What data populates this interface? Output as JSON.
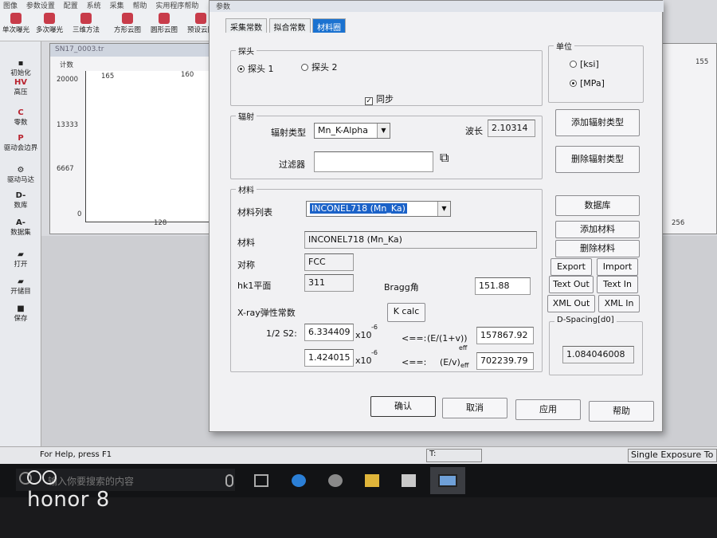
{
  "background_app": {
    "menu": [
      "图像",
      "参数设置",
      "配置",
      "系统",
      "采集",
      "帮助",
      "实用程序帮助"
    ],
    "toolbar": [
      "单次曝光",
      "多次曝光",
      "三维方法",
      "方形云图",
      "圆形云图",
      "预设云图"
    ],
    "sidebar": [
      {
        "glyph": "",
        "label": "初始化"
      },
      {
        "glyph": "HV",
        "label": "高压"
      },
      {
        "glyph": "C",
        "label": "零数"
      },
      {
        "glyph": "P",
        "label": "驱动会边界"
      },
      {
        "glyph": "",
        "label": "驱动马达"
      },
      {
        "glyph": "D-",
        "label": "数库"
      },
      {
        "glyph": "A-",
        "label": "数据集"
      },
      {
        "glyph": "",
        "label": "打开"
      },
      {
        "glyph": "",
        "label": "开储目"
      },
      {
        "glyph": "",
        "label": "保存"
      }
    ],
    "plot": {
      "window_title": "SN17_0003.tr",
      "y_title": "计数",
      "y_ticks": [
        "20000",
        "13333",
        "6667",
        "0"
      ],
      "x_ticks": [
        "128"
      ],
      "peaks": [
        "165",
        "160"
      ],
      "right_x_tick": "256",
      "right_peak": "155"
    },
    "status_help": "For Help, press F1",
    "status_t": "T:",
    "status_mode": "Single Exposure To"
  },
  "taskbar": {
    "search_placeholder": "输入你要搜索的内容"
  },
  "watermark": "honor 8",
  "dialog": {
    "title": "参数",
    "tabs": [
      "采集常数",
      "拟合常数",
      "材料圈"
    ],
    "active_tab": 2,
    "probe": {
      "title": "探头",
      "option1": "探头 1",
      "option2": "探头 2",
      "selected": 1,
      "sync_label": "同步",
      "sync_checked": true
    },
    "unit": {
      "title": "单位",
      "option_ksi": "[ksi]",
      "option_mpa": "[MPa]",
      "selected": "mpa"
    },
    "radiation": {
      "title": "辐射",
      "type_label": "辐射类型",
      "type_value": "Mn_K-Alpha",
      "wavelength_label": "波长",
      "wavelength_value": "2.10314",
      "filter_label": "过滤器",
      "filter_value": ""
    },
    "right_buttons": {
      "add_radiation": "添加辐射类型",
      "delete_radiation": "删除辐射类型",
      "database": "数据库",
      "add_material": "添加材料",
      "delete_material": "删除材料",
      "export": "Export",
      "import": "Import",
      "text_out": "Text Out",
      "text_in": "Text In",
      "xml_out": "XML Out",
      "xml_in": "XML In"
    },
    "material": {
      "title": "材料",
      "list_label": "材料列表",
      "list_value": "INCONEL718 (Mn_Ka)",
      "name_label": "材料",
      "name_value": "INCONEL718 (Mn_Ka)",
      "symmetry_label": "对称",
      "symmetry_value": "FCC",
      "hkl_label": "hk1平面",
      "hkl_value": "311",
      "bragg_label": "Bragg角",
      "bragg_value": "151.88",
      "xec_label": "X-ray弹性常数",
      "kcalc_label": "K calc",
      "half_s2_label": "1/2 S2:",
      "half_s2_value": "6.334409",
      "s1_value": "1.424015",
      "x10": "x10",
      "exp": "-6",
      "arrow": "<==:",
      "formula1": "(E/(1+v))",
      "formula2": "(E/v)",
      "eff": "eff",
      "e1v_value": "157867.92",
      "ev_value": "702239.79"
    },
    "dspacing": {
      "title": "D-Spacing[d0]",
      "value": "1.084046008"
    },
    "footer": {
      "ok": "确认",
      "cancel": "取消",
      "apply": "应用",
      "help": "帮助"
    }
  }
}
